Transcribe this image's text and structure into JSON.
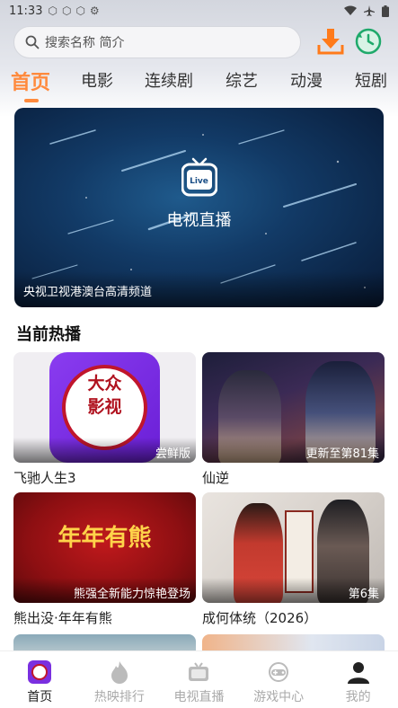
{
  "status_bar": {
    "time": "11:33"
  },
  "search": {
    "placeholder": "搜索名称 简介"
  },
  "tabs": [
    {
      "label": "首页",
      "active": true
    },
    {
      "label": "电影"
    },
    {
      "label": "连续剧"
    },
    {
      "label": "综艺"
    },
    {
      "label": "动漫"
    },
    {
      "label": "短剧"
    }
  ],
  "banner": {
    "live_icon_text": "Live",
    "title": "电视直播",
    "caption": "央视卫视港澳台高清频道"
  },
  "section": {
    "title": "当前热播"
  },
  "cards": [
    {
      "title": "飞驰人生3",
      "badge": "尝鲜版",
      "logo_text": "大众影视"
    },
    {
      "title": "仙逆",
      "badge": "更新至第81集"
    },
    {
      "title": "熊出没·年年有熊",
      "badge": "熊强全新能力惊艳登场",
      "art_text": "年年有熊"
    },
    {
      "title": "成何体统（2026）",
      "badge": "第6集"
    }
  ],
  "bottom_nav": [
    {
      "label": "首页",
      "icon": "home-app-icon",
      "active": true
    },
    {
      "label": "热映排行",
      "icon": "fire-icon"
    },
    {
      "label": "电视直播",
      "icon": "tv-icon"
    },
    {
      "label": "游戏中心",
      "icon": "gamepad-icon"
    },
    {
      "label": "我的",
      "icon": "user-icon"
    }
  ],
  "colors": {
    "accent": "#ff8a3d",
    "download": "#ff7a1a",
    "history": "#1fa96b"
  }
}
